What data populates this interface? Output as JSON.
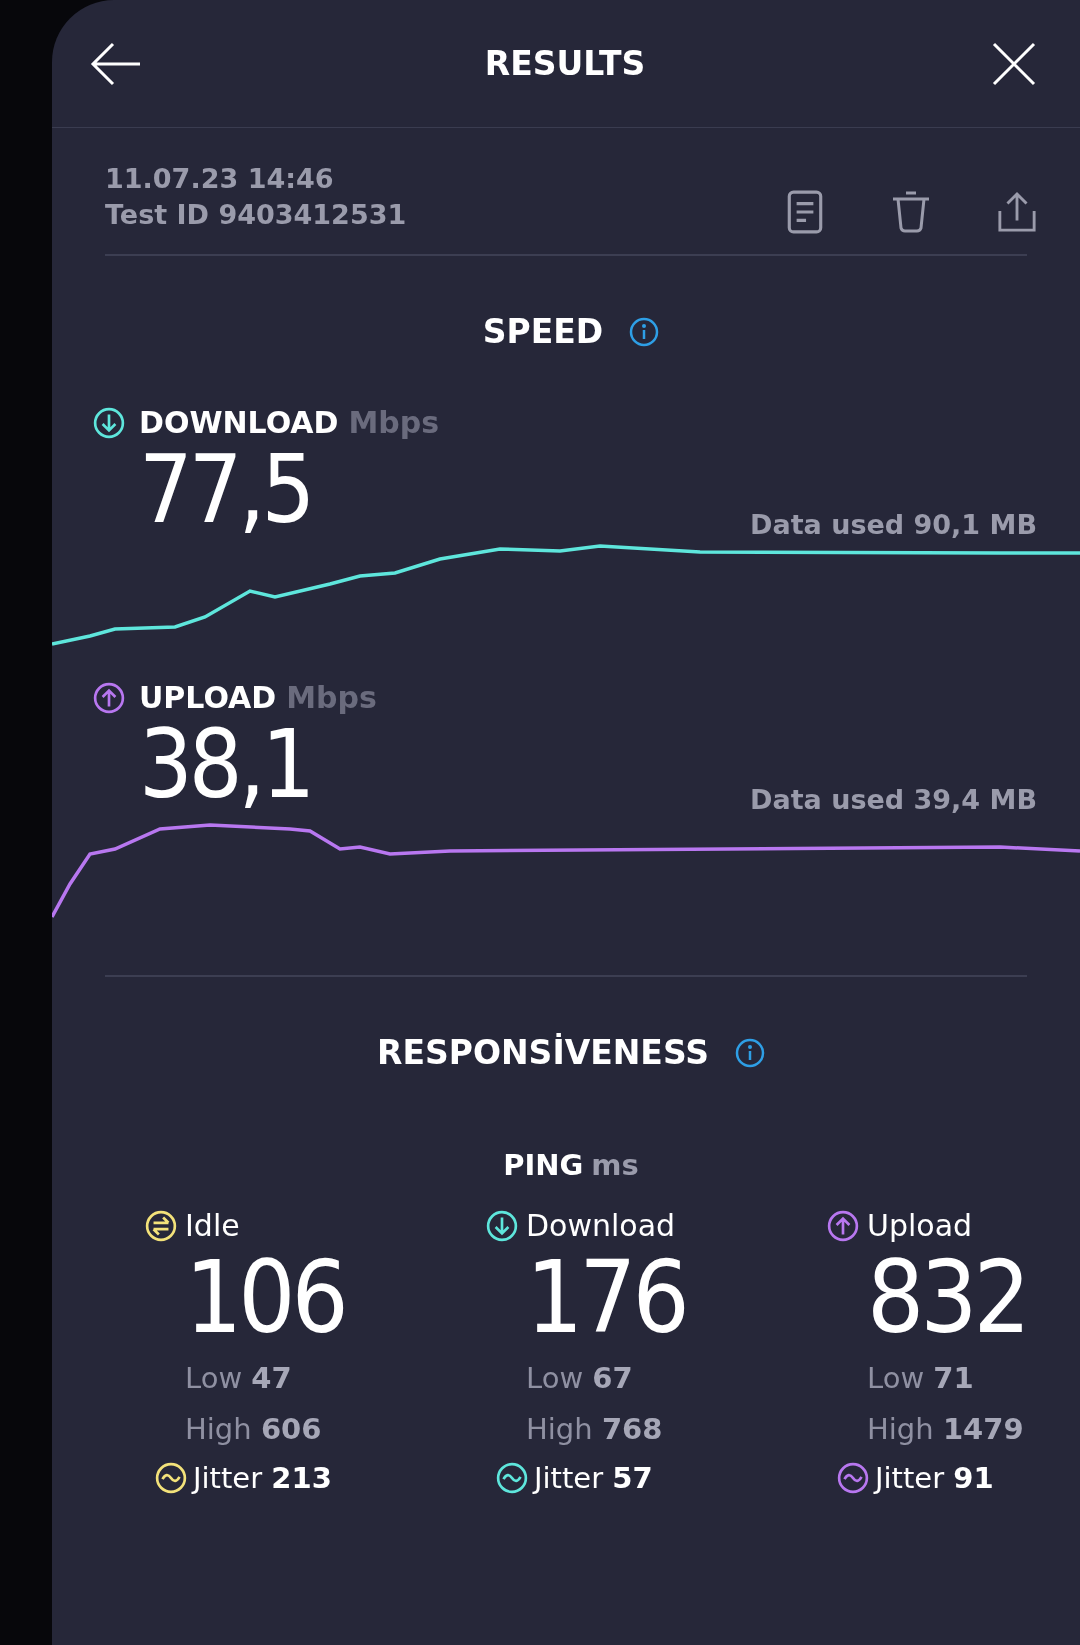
{
  "header": {
    "title": "RESULTS"
  },
  "test_info": {
    "date": "11.07.23 14:46",
    "test_id": "Test ID 9403412531"
  },
  "speed": {
    "title": "SPEED",
    "metrics": [
      {
        "kind": "download",
        "label": "DOWNLOAD",
        "unit": "Mbps",
        "value": "77,5",
        "data_used": "Data used 90,1 MB",
        "color": "#5ee6dc"
      },
      {
        "kind": "upload",
        "label": "UPLOAD",
        "unit": "Mbps",
        "value": "38,1",
        "data_used": "Data used 39,4 MB",
        "color": "#b877f0"
      }
    ]
  },
  "responsiveness": {
    "title": "RESPONSİVENESS",
    "ping_label": "PING",
    "ping_unit": "ms",
    "columns": [
      {
        "kind": "idle",
        "label": "Idle",
        "value": "106",
        "low": "Low **47**",
        "high": "High **606**",
        "jitter": "Jitter **213**",
        "color": "#f3e27a"
      },
      {
        "kind": "download",
        "label": "Download",
        "value": "176",
        "low": "Low **67**",
        "high": "High **768**",
        "jitter": "Jitter **57**",
        "color": "#5ee6dc"
      },
      {
        "kind": "upload",
        "label": "Upload",
        "value": "832",
        "low": "Low **71**",
        "high": "High **1479**",
        "jitter": "Jitter **91**",
        "color": "#b877f0"
      }
    ]
  }
}
